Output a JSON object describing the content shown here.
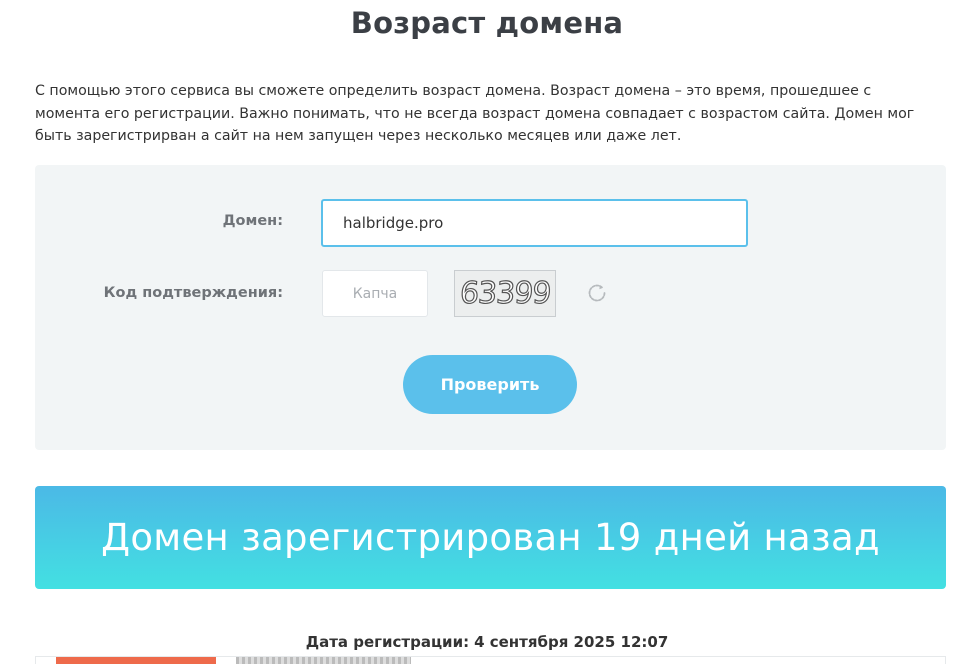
{
  "page": {
    "title": "Возраст домена",
    "intro": "С помощью этого сервиса вы сможете определить возраст домена. Возраст домена – это время, прошедшее с момента его регистрации. Важно понимать, что не всегда возраст домена совпадает с возрастом сайта. Домен мог быть зарегистрирван а сайт на нем запущен через несколько месяцев или даже лет."
  },
  "form": {
    "domain_label": "Домен:",
    "domain_value": "halbridge.pro",
    "captcha_label": "Код подтверждения:",
    "captcha_placeholder": "Капча",
    "captcha_code": "63399",
    "refresh_icon": "refresh-icon",
    "submit_label": "Проверить"
  },
  "result": {
    "message": "Домен зарегистрирован 19 дней назад",
    "registration_label": "Дата регистрации:",
    "registration_value": "4 сентября 2025 12:07"
  },
  "colors": {
    "accent": "#5bc0eb",
    "banner_top": "#4bb9e6",
    "banner_bottom": "#43e0e2",
    "panel_bg": "#f2f5f6"
  }
}
